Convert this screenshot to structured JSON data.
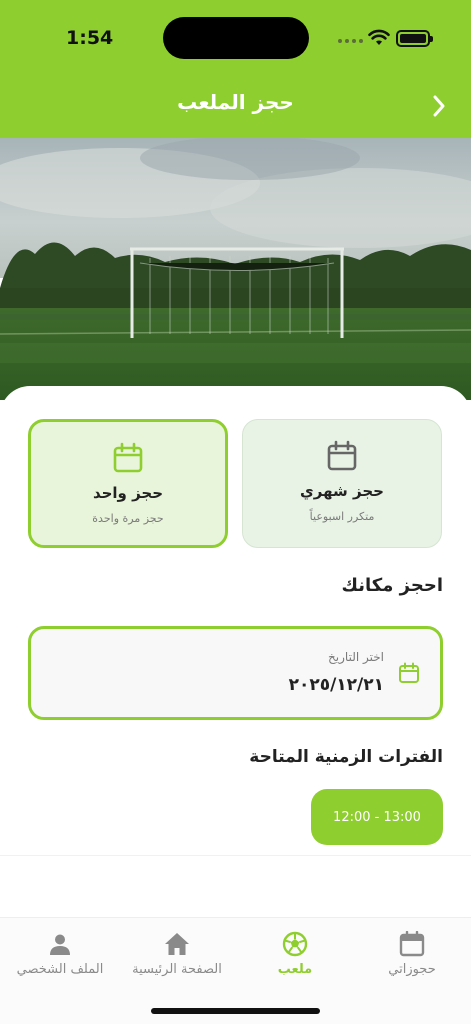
{
  "status_bar": {
    "time": "1:54"
  },
  "nav": {
    "title": "حجز الملعب",
    "back_icon": "chevron-right-icon"
  },
  "booking_types": [
    {
      "title": "حجز واحد",
      "subtitle": "حجز مرة واحدة",
      "icon": "calendar-icon",
      "selected": true
    },
    {
      "title": "حجز شهري",
      "subtitle": "متكرر اسبوعياً",
      "icon": "calendar-icon",
      "selected": false
    }
  ],
  "book_section": {
    "title": "احجز مكانك"
  },
  "date_field": {
    "label": "اختر التاريخ",
    "value": "٢٠٢٥/١٢/٢١",
    "icon": "calendar-icon"
  },
  "slots_section": {
    "title": "الفترات الزمنية المتاحة"
  },
  "slots": [
    {
      "label": "12:00 - 13:00",
      "selected": true
    }
  ],
  "tabbar": {
    "items": [
      {
        "label": "الملف الشخصي",
        "icon": "person-icon"
      },
      {
        "label": "الصفحة الرئيسية",
        "icon": "home-icon"
      },
      {
        "label": "ملعب",
        "icon": "soccer-ball-icon",
        "active": true
      },
      {
        "label": "حجوزاتي",
        "icon": "calendar-icon"
      }
    ]
  },
  "colors": {
    "accent": "#8fce2f",
    "selected_card_bg": "#e9f5da",
    "card_bg": "#e8f3e6"
  }
}
